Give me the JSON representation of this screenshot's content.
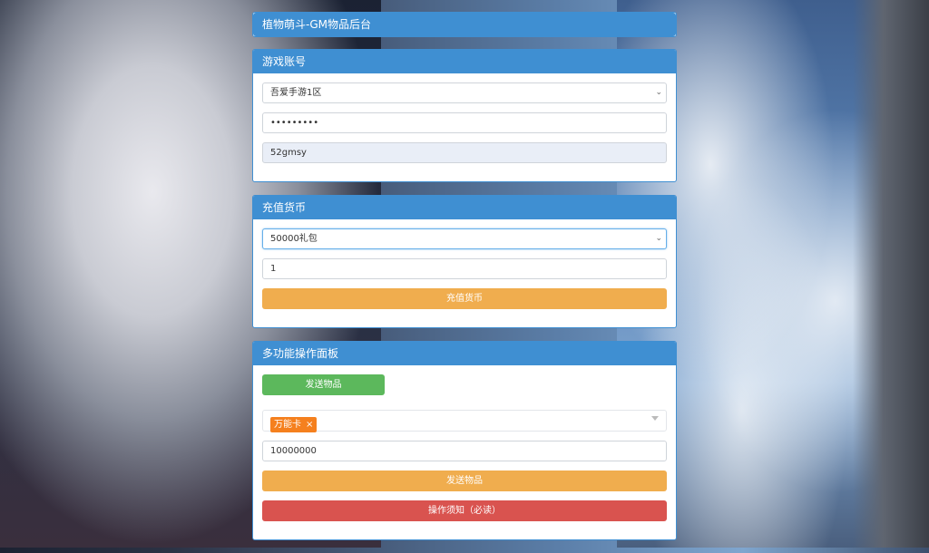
{
  "header": {
    "title": "植物萌斗-GM物品后台"
  },
  "account_panel": {
    "title": "游戏账号",
    "server_select": {
      "value": "吾爱手游1区"
    },
    "password": {
      "value": "•••••••••"
    },
    "account": {
      "value": "52gmsy"
    }
  },
  "recharge_panel": {
    "title": "充值货币",
    "package_select": {
      "value": "50000礼包"
    },
    "quantity": {
      "value": "1"
    },
    "submit_label": "充值货币"
  },
  "multi_panel": {
    "title": "多功能操作面板",
    "send_top_label": "发送物品",
    "selected_item": {
      "label": "万能卡",
      "remove": "×"
    },
    "amount": {
      "value": "10000000"
    },
    "send_label": "发送物品",
    "notice_label": "操作须知（必读）"
  },
  "colors": {
    "primary": "#3f8fd2",
    "warning": "#f0ad4e",
    "danger": "#d9534f",
    "success": "#5cb85c",
    "tag": "#f5801e"
  },
  "icons": {
    "select_chevron": "chevron-down-icon",
    "multiselect_caret": "caret-down-icon",
    "tag_remove": "close-icon"
  }
}
